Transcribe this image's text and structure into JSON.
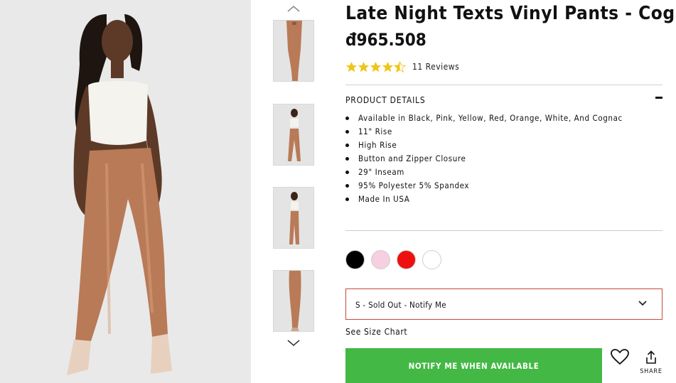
{
  "product": {
    "title": "Late Night Texts Vinyl Pants - Cognac",
    "price": "đ965.508",
    "rating": {
      "value": 4.5,
      "max": 5,
      "reviews_label": "11 Reviews"
    }
  },
  "gallery": {
    "main_image": "model-wearing-cognac-vinyl-pants",
    "thumbnail_count": 4,
    "up_arrow_icon": "chevron-up-icon",
    "down_arrow_icon": "chevron-down-icon"
  },
  "details": {
    "section_title": "PRODUCT DETAILS",
    "collapse_icon": "minus-icon",
    "items": [
      "Available in Black, Pink, Yellow, Red, Orange, White, And Cognac",
      "11\" Rise",
      "High Rise",
      "Button and Zipper Closure",
      "29\" Inseam",
      "95% Polyester 5% Spandex",
      "Made In USA"
    ]
  },
  "swatches": [
    {
      "name": "black",
      "color": "#000000"
    },
    {
      "name": "pink",
      "color": "#f6cfe0"
    },
    {
      "name": "red",
      "color": "#ee1010"
    },
    {
      "name": "white",
      "color": "#ffffff"
    }
  ],
  "size": {
    "selected": "S - Sold Out - Notify Me",
    "size_chart_link": "See Size Chart"
  },
  "actions": {
    "notify_label": "NOTIFY ME WHEN AVAILABLE",
    "notify_color": "#43b845",
    "favorite_icon": "heart-icon",
    "share_icon": "share-icon",
    "share_label": "SHARE"
  }
}
